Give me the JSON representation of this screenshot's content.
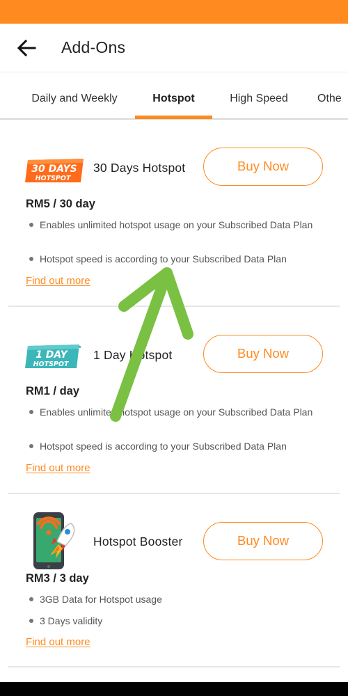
{
  "header": {
    "title": "Add-Ons"
  },
  "tabs": [
    {
      "label": "Daily and Weekly"
    },
    {
      "label": "Hotspot"
    },
    {
      "label": "High Speed"
    },
    {
      "label": "Othe"
    }
  ],
  "plans": [
    {
      "logo_line1": "30 DAYS",
      "logo_line2": "HOTSPOT",
      "name": "30 Days Hotspot",
      "buy_label": "Buy Now",
      "price": "RM5 / 30 day",
      "features": [
        "Enables unlimited hotspot usage on your Subscribed Data Plan",
        "Hotspot speed is according to your Subscribed Data Plan"
      ],
      "link": "Find out more"
    },
    {
      "logo_line1": "1 DAY",
      "logo_line2": "HOTSPOT",
      "name": "1 Day Hotspot",
      "buy_label": "Buy Now",
      "price": "RM1 / day",
      "features": [
        "Enables unlimited hotspot usage on your Subscribed Data Plan",
        "Hotspot speed is according to your Subscribed Data Plan"
      ],
      "link": "Find out more"
    },
    {
      "name": "Hotspot Booster",
      "buy_label": "Buy Now",
      "price": "RM3 / 3 day",
      "features": [
        "3GB Data for Hotspot usage",
        "3 Days validity"
      ],
      "link": "Find out more"
    }
  ],
  "colors": {
    "accent": "#ff8a1f",
    "annotation_arrow": "#7ac043",
    "teal_logo": "#3bb6b9"
  },
  "icons": [
    "back-arrow-icon",
    "hotspot-signal-icon",
    "rocket-icon",
    "phone-icon"
  ]
}
